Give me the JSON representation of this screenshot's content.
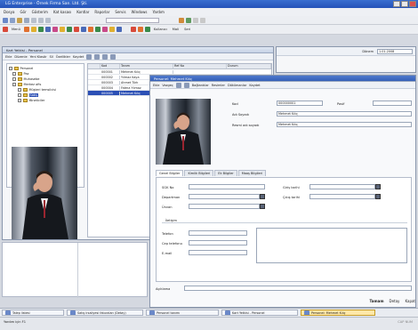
{
  "app": {
    "title": "LG Enterprise - Örnek Firma San. Ltd. Şti.",
    "menu": [
      "Dosya",
      "Gör",
      "Gösterim",
      "Kat kasası",
      "Kontlar",
      "Raporlar",
      "Servis",
      "Windows",
      "Yardım"
    ]
  },
  "toolbar2": {
    "menu_label": "Menü",
    "labels": [
      "Kullanıcı",
      "Mali",
      "Seri"
    ]
  },
  "toolbar3": {
    "search_label": "Ekle"
  },
  "left_window": {
    "title": "Kart Yetkisi - Personel",
    "toolbar": [
      "Ekle",
      "Düzenle",
      "Yeni Klasör",
      "Sil",
      "Özellikler",
      "Kaydet"
    ],
    "tree": [
      "Personel",
      "Paz",
      "Muhasebe",
      "Merkez ofis",
      "Müşteri temsilcisi",
      "Satış",
      "Yöneticiler"
    ],
    "grid_headers": [
      "Kod",
      "Tanım",
      "Ref No",
      "Durum"
    ],
    "grid_rows": [
      [
        "000001",
        "Mehmet Kılıç"
      ],
      [
        "000002",
        "Yılmaz Kaya"
      ],
      [
        "000003",
        "Ahmet Türk"
      ],
      [
        "000004",
        "Fatma Yılmaz"
      ],
      [
        "000005",
        "Mehmet Kılıç"
      ]
    ],
    "selected_row": 4
  },
  "right_panel": {
    "label": "Dönem",
    "value": "1.01.2008"
  },
  "detail_window": {
    "title": "Personel: Mehmet Kılıç",
    "toolbar": [
      "Ekle",
      "Vazgeç",
      "Bağlantılar",
      "Resimler",
      "Dökümanlar",
      "Kaydet"
    ],
    "fields": {
      "kod_label": "Kod",
      "kod_value": "000000001",
      "pasif_label": "Pasif",
      "adsoyad_label": "Adı Soyadı",
      "adsoyad_value": "Mehmet Kılıç",
      "resmi_label": "Resmi adı soyadı",
      "resmi_value": "Mehmet Kılıç"
    },
    "tabs": [
      "Genel Bilgiler",
      "Kimlik Bilgileri",
      "Ek Bilgiler",
      "Maaş Bilgileri"
    ],
    "genel": {
      "sgk_label": "SGK No",
      "departman_label": "Departman",
      "unvan_label": "Ünvan",
      "giris_label": "Giriş tarihi",
      "cikis_label": "Çıkış tarihi",
      "iletisim_label": "İletişim",
      "telefon_label": "Telefon",
      "cep_label": "Cep telefonu",
      "email_label": "E-mail",
      "aciklama_label": "Açıklama"
    },
    "buttons": [
      "Tamam",
      "Detay",
      "Kapat"
    ]
  },
  "taskbar": [
    "Talep listesi",
    "Satış irsaliyesi faturaları (Detay)",
    "Personel tanımı",
    "Kart Yetkisi - Personel",
    "Personel: Mehmet Kılıç"
  ],
  "status": {
    "text": "Yardım için F1",
    "right": "CAP NUM"
  }
}
